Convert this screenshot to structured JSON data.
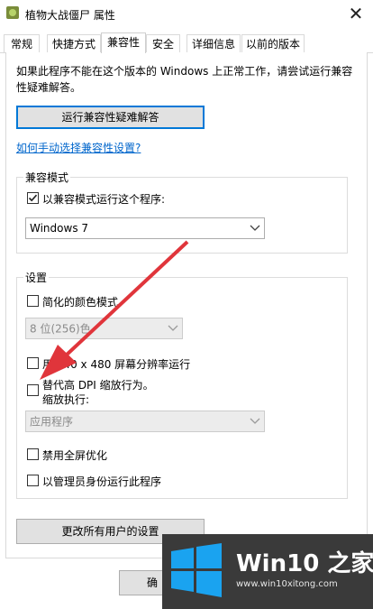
{
  "window": {
    "title": "植物大战僵尸 属性"
  },
  "tabs": [
    {
      "label": "常规"
    },
    {
      "label": "快捷方式"
    },
    {
      "label": "兼容性"
    },
    {
      "label": "安全"
    },
    {
      "label": "详细信息"
    },
    {
      "label": "以前的版本"
    }
  ],
  "compat": {
    "intro": "如果此程序不能在这个版本的 Windows 上正常工作，请尝试运行兼容性疑难解答。",
    "troubleshoot_button": "运行兼容性疑难解答",
    "manual_link": "如何手动选择兼容性设置?",
    "mode_group_title": "兼容模式",
    "run_in_mode_label": "以兼容模式运行这个程序:",
    "run_in_mode_checked": true,
    "os_select_value": "Windows 7"
  },
  "settings": {
    "group_title": "设置",
    "reduced_color_label": "简化的颜色模式",
    "color_select_value": "8 位(256)色",
    "resolution_label": "用 640 x 480 屏幕分辨率运行",
    "dpi_label": "替代高 DPI 缩放行为。",
    "dpi_sub_label": "缩放执行:",
    "dpi_select_value": "应用程序",
    "fullscreen_label": "禁用全屏优化",
    "admin_label": "以管理员身份运行此程序"
  },
  "footer": {
    "all_users_button": "更改所有用户的设置",
    "ok_button": "确"
  },
  "watermark": {
    "brand": "Win10 之家",
    "url": "www.win10xitong.com"
  },
  "colors": {
    "accent": "#0078d7",
    "link": "#0066cc",
    "arrow": "#e0353b",
    "logo_bg": "#3a3a3a"
  }
}
